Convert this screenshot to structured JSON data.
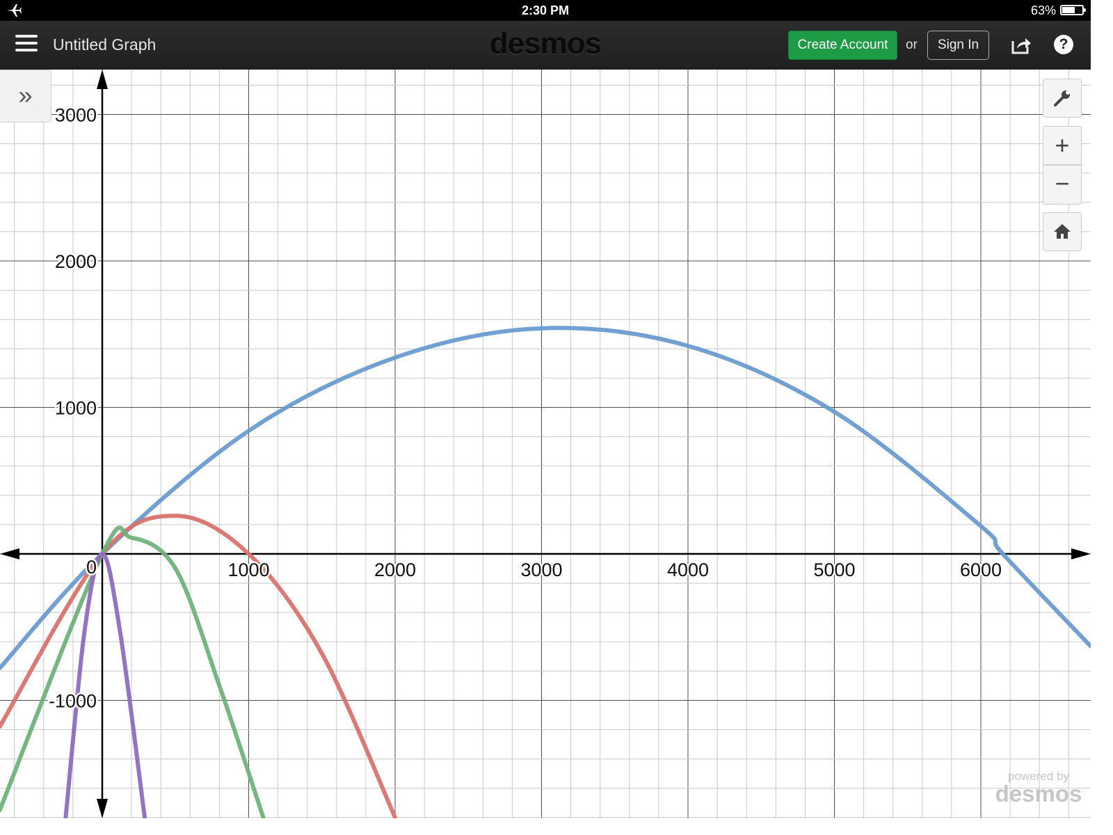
{
  "status_bar": {
    "time": "2:30 PM",
    "battery": "63%",
    "battery_level": 0.63
  },
  "header": {
    "graph_title": "Untitled Graph",
    "brand": "desmos",
    "create_account": "Create Account",
    "or": "or",
    "sign_in": "Sign In"
  },
  "icons": {
    "menu": "hamburger-icon",
    "share": "share-icon",
    "help": "help-icon",
    "expand": "double-chevron-right-icon",
    "settings": "wrench-icon",
    "zoom_in": "plus-icon",
    "zoom_out": "minus-icon",
    "home": "home-icon",
    "airplane": "airplane-mode-icon"
  },
  "graph": {
    "x_ticks": [
      "1000",
      "2000",
      "3000",
      "4000",
      "5000",
      "6000"
    ],
    "y_ticks": [
      "3000",
      "2000",
      "1000",
      "-1000"
    ],
    "origin": "0"
  },
  "watermark": {
    "line1": "powered by",
    "line2": "desmos"
  },
  "chart_data": {
    "type": "line",
    "title": "",
    "xlabel": "",
    "ylabel": "",
    "xlim": [
      -700,
      6750
    ],
    "ylim": [
      -1800,
      3300
    ],
    "grid": true,
    "series": [
      {
        "color": "#6b9bd1",
        "x": [
          -700,
          0,
          1000,
          2000,
          3000,
          4000,
          5000,
          6000,
          6150,
          6750
        ],
        "y": [
          -780,
          0,
          840,
          1340,
          1540,
          1420,
          970,
          190,
          0,
          -630
        ]
      },
      {
        "color": "#d9736e",
        "x": [
          -700,
          0,
          500,
          1000,
          1500,
          2000
        ],
        "y": [
          -1180,
          0,
          260,
          0,
          -680,
          -1800
        ]
      },
      {
        "color": "#6fb27a",
        "x": [
          -700,
          0,
          200,
          500,
          800,
          1100
        ],
        "y": [
          -1750,
          0,
          110,
          -100,
          -900,
          -1800
        ]
      },
      {
        "color": "#8e6bbf",
        "x": [
          -250,
          -120,
          0,
          120,
          290
        ],
        "y": [
          -1800,
          -520,
          0,
          -520,
          -1800
        ]
      }
    ]
  }
}
